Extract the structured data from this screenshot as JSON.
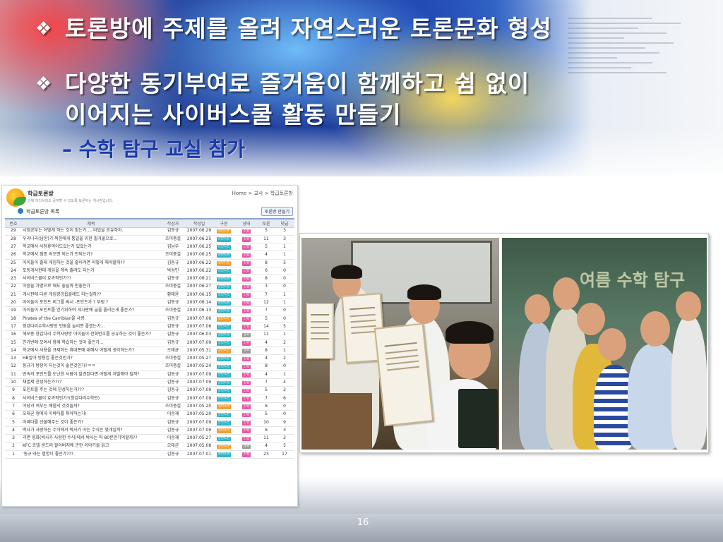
{
  "slide": {
    "bullet_mark": "❖",
    "bullet1": "토론방에 주제를 올려 자연스러운 토론문화 형성",
    "bullet2_line1": "다양한 동기부여로 즐거움이 함께하고 쉼 없이",
    "bullet2_line2": "이어지는 사이버스쿨 활동 만들기",
    "sub": "– 수학 탐구 교실 참가",
    "page_number": "16"
  },
  "board": {
    "title": "학급토론방",
    "description": "언제 어디서라도 공부할 수 있도록 토론하는 게시판입니다.",
    "breadcrumb": "Home > 교사 > 학급토론방",
    "list_title": "학급토론방 목록",
    "make_button": "토론방 만들기",
    "columns": [
      "번호",
      "제목",
      "작성자",
      "작성일",
      "구분",
      "상태",
      "토론",
      "댓글"
    ],
    "rows": [
      {
        "no": "29",
        "title": "시험공부는 어떻게 하는 것이 맞는가.... 비법을 공유하자.",
        "author": "김동규",
        "date": "2007.06.29",
        "type": "일반토론",
        "state": "진행",
        "debate": "5",
        "reply": "3"
      },
      {
        "no": "28",
        "title": "우리나라(남한)가 북한에게 통일을 위한 필거물으로...",
        "author": "조미중설",
        "date": "2007.06.25",
        "type": "찬반토론",
        "state": "진행",
        "debate": "11",
        "reply": "3"
      },
      {
        "no": "27",
        "title": "학교에서 사탕휴먹어도있는가 있었는가",
        "author": "김남우",
        "date": "2007.06.25",
        "type": "찬반토론",
        "state": "진행",
        "debate": "5",
        "reply": "1"
      },
      {
        "no": "26",
        "title": "학교에서 점증 씌오면 되는가 안되는가?",
        "author": "조미중설",
        "date": "2007.06.25",
        "type": "찬반토론",
        "state": "진행",
        "debate": "4",
        "reply": "1"
      },
      {
        "no": "25",
        "title": "아이들이 졸래 게임하는 것을 줄이려면 어떻게 해야할까??",
        "author": "김동규",
        "date": "2007.06.22",
        "type": "일반토론",
        "state": "진행",
        "debate": "8",
        "reply": "5"
      },
      {
        "no": "24",
        "title": "포동게서현태 게임을 계속 출려도 되는가",
        "author": "박성민",
        "date": "2007.06.22",
        "type": "찬반토론",
        "state": "진행",
        "debate": "6",
        "reply": "0"
      },
      {
        "no": "23",
        "title": "사이버스쿨이 효과적인가??",
        "author": "김동규",
        "date": "2007.06.21",
        "type": "찬반토론",
        "state": "진행",
        "debate": "8",
        "reply": "0"
      },
      {
        "no": "22",
        "title": "이름을 가명으로 해도 좋을까 안좋은가",
        "author": "조미중설",
        "date": "2007.06.27",
        "type": "찬반토론",
        "state": "진행",
        "debate": "3",
        "reply": "0"
      },
      {
        "no": "21",
        "title": "게시판에 다른 게임광공옵클레도 되는걸까??",
        "author": "황태윤",
        "date": "2007.06.15",
        "type": "찬반토론",
        "state": "진행",
        "debate": "7",
        "reply": "1"
      },
      {
        "no": "20",
        "title": "아이들이 포인트 버그를 써서 -포인트가 ? 부럼 ?",
        "author": "김동규",
        "date": "2007.06.14",
        "type": "찬반토론",
        "state": "진행",
        "debate": "12",
        "reply": "1"
      },
      {
        "no": "19",
        "title": "아이들이 포인트를 얻기위하여 게시판에 글을 올리는게 좋은가?",
        "author": "조미중설",
        "date": "2007.06.13",
        "type": "찬반토론",
        "state": "진행",
        "debate": "7",
        "reply": "0"
      },
      {
        "no": "18",
        "title": "Pirates of the Carribian을 사랑",
        "author": "김동규",
        "date": "2007.07.06",
        "type": "일반토론",
        "state": "진행",
        "debate": "5",
        "reply": "0"
      },
      {
        "no": "17",
        "title": "정강다리수학사랑방 인원을 늘리면 좋겠는가...",
        "author": "김동규",
        "date": "2007.07.06",
        "type": "찬반토론",
        "state": "진행",
        "debate": "14",
        "reply": "5"
      },
      {
        "no": "16",
        "title": "해모똥 창갑다리 수학사랑방 아이들이 전화번호를 공유하는 것이 좋은가?",
        "author": "김동규",
        "date": "2007.06.03",
        "type": "찬반토론",
        "state": "종료",
        "debate": "11",
        "reply": "1"
      },
      {
        "no": "15",
        "title": "민가번에 모여서 함께 학습하는 것이 좋은가...",
        "author": "김동규",
        "date": "2007.07.09",
        "type": "찬반토론",
        "state": "진행",
        "debate": "4",
        "reply": "2"
      },
      {
        "no": "14",
        "title": "학교에서 사용을 규제하는 휴대폰에 대해서 어떻게 생각하는가?",
        "author": "오태균",
        "date": "2007.05.31",
        "type": "일반토론",
        "state": "종료",
        "debate": "8",
        "reply": "1"
      },
      {
        "no": "13",
        "title": "HB알아 방용업 좋은것인가?",
        "author": "조미중설",
        "date": "2007.05.27",
        "type": "찬반토론",
        "state": "진행",
        "debate": "4",
        "reply": "2"
      },
      {
        "no": "12",
        "title": "동규가 방장이 되는것이 좋은것인가?ㅋㅋ",
        "author": "조미중설",
        "date": "2007.05.24",
        "type": "찬반토론",
        "state": "진행",
        "debate": "8",
        "reply": "0"
      },
      {
        "no": "11",
        "title": "반속의 포인트를 도난한 사람이 발견된다면 어떻게 처벌해야 될까?",
        "author": "김동규",
        "date": "2007.07.09",
        "type": "찬반토론",
        "state": "진행",
        "debate": "4",
        "reply": "1"
      },
      {
        "no": "10",
        "title": "채벌제 찬성하는가???",
        "author": "김동규",
        "date": "2007.07.09",
        "type": "찬반토론",
        "state": "진행",
        "debate": "7",
        "reply": "4"
      },
      {
        "no": "9",
        "title": "포인트를 주는 것에 찬성하는가???",
        "author": "김동규",
        "date": "2007.07.09",
        "type": "찬반토론",
        "state": "진행",
        "debate": "5",
        "reply": "2"
      },
      {
        "no": "8",
        "title": "사이버스쿨이 효과적인가?(창갑다리수학반)",
        "author": "김동규",
        "date": "2007.07.09",
        "type": "찬반토론",
        "state": "진행",
        "debate": "7",
        "reply": "6"
      },
      {
        "no": "7",
        "title": "야당과 여부는 배움의 것것들까?",
        "author": "조미중설",
        "date": "2007.05.20",
        "type": "일반토론",
        "state": "진행",
        "debate": "6",
        "reply": "0"
      },
      {
        "no": "6",
        "title": "오태균 형에게 이바타를 줘야하는가!",
        "author": "이승재",
        "date": "2007.05.20",
        "type": "찬반토론",
        "state": "진행",
        "debate": "5",
        "reply": "0"
      },
      {
        "no": "5",
        "title": "아바타를 선물해주는 것이 좋은가?",
        "author": "김동규",
        "date": "2007.07.09",
        "type": "찬반토론",
        "state": "진행",
        "debate": "10",
        "reply": "9"
      },
      {
        "no": "4",
        "title": "박사가 사랑하는 수식에서 박사가 아는 수식은 몇개일까?",
        "author": "김동규",
        "date": "2007.07.09",
        "type": "일반토론",
        "state": "진행",
        "debate": "6",
        "reply": "3"
      },
      {
        "no": "3",
        "title": "괴면 영화(박사가 사랑한 수식)에서 박사는 딱 80분만기억할까??",
        "author": "이승재",
        "date": "2007.05.27",
        "type": "찬반토론",
        "state": "진행",
        "debate": "11",
        "reply": "2"
      },
      {
        "no": "2",
        "title": "KFC 코넬 샌드러 할아버지에 관한 이야기를 읽고",
        "author": "오태균",
        "date": "2007.05.08",
        "type": "일반토론",
        "state": "종료",
        "debate": "4",
        "reply": "5"
      },
      {
        "no": "1",
        "title": "'동규'라는 별명이 좋은가???",
        "author": "김동규",
        "date": "2007.07.01",
        "type": "찬반토론",
        "state": "진행",
        "debate": "23",
        "reply": "17"
      }
    ]
  },
  "colors": {
    "tag_general": "#f0a030",
    "tag_proscon": "#2fb6c8",
    "tag_open": "#e85aa8",
    "tag_closed": "#9a9a9a",
    "title_text": "#ffffff",
    "sub_text": "#1a3aa8"
  },
  "photos": {
    "chalk_text": "여름 수학 탐구"
  }
}
